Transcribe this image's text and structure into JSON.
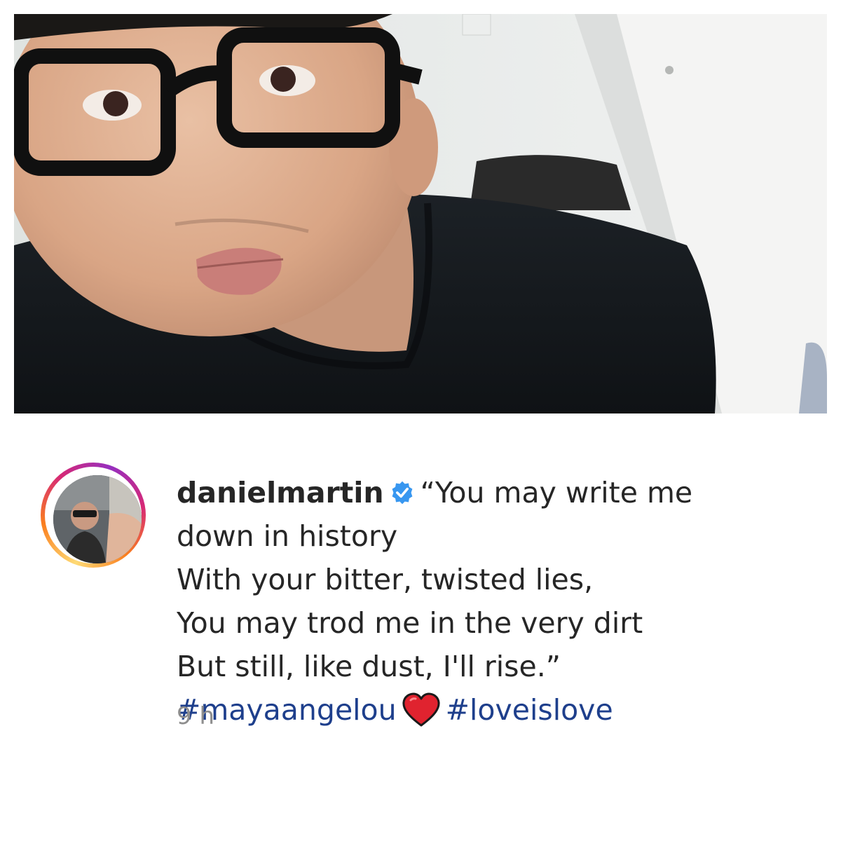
{
  "post": {
    "username": "danielmartin",
    "verified": true,
    "caption_lines": [
      "“You may write me",
      "down in history",
      "With your bitter, twisted lies,",
      "You may trod me in the very dirt",
      "But still, like dust, I'll rise.”"
    ],
    "hashtags": [
      "#mayaangelou",
      "#loveislove"
    ],
    "emoji": "red-heart",
    "timestamp": "9 h"
  },
  "icons": {
    "verified_badge": "verified-check-icon",
    "heart": "red-heart-icon"
  },
  "colors": {
    "hashtag": "#1e3f8c",
    "verified": "#3897f0",
    "timestamp": "#8e8e8e",
    "text": "#262626",
    "heart": "#e0232f"
  }
}
